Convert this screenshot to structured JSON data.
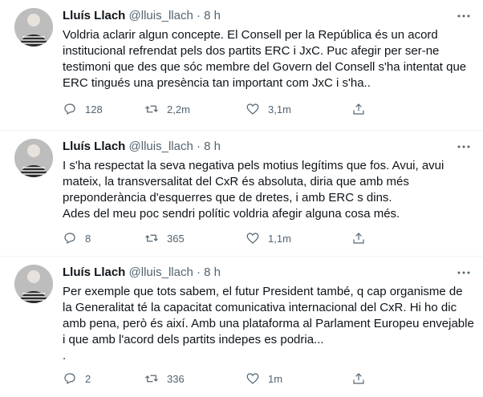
{
  "tweets": [
    {
      "name": "Lluís Llach",
      "handle": "@lluis_llach",
      "time": "8 h",
      "lines": [
        "Voldria aclarir algun concepte. El Consell per la República és un acord",
        "institucional refrendat pels dos partits ERC i JxC. Puc afegir per ser-ne",
        "testimoni que des que sóc membre del Govern del Consell s'ha intentat que",
        "ERC  tingués una presència tan important com JxC i s'ha.."
      ],
      "replies": "128",
      "retweets": "2,2m",
      "likes": "3,1m"
    },
    {
      "name": "Lluís Llach",
      "handle": "@lluis_llach",
      "time": "8 h",
      "lines": [
        "I s'ha respectat la seva negativa pels motius legítims que fos. Avui, avui",
        "mateix, la transversalitat del CxR és absoluta, diria que amb més",
        "preponderància d'esquerres que de dretes, i amb ERC s dins.",
        "Ades del meu poc sendri polític voldria afegir alguna cosa més."
      ],
      "replies": "8",
      "retweets": "365",
      "likes": "1,1m"
    },
    {
      "name": "Lluís Llach",
      "handle": "@lluis_llach",
      "time": "8 h",
      "lines": [
        "Per exemple que tots sabem, el futur President també, q cap organisme de",
        "la Generalitat té la capacitat comunicativa internacional del CxR. Hi ho dic",
        "amb pena, però és així. Amb una plataforma al Parlament Europeu envejable",
        "i que amb l'acord dels partits indepes es podria...",
        "."
      ],
      "replies": "2",
      "retweets": "336",
      "likes": "1m"
    }
  ],
  "icons": {
    "reply": "reply-icon",
    "retweet": "retweet-icon",
    "like": "heart-icon",
    "share": "share-icon",
    "more": "more-icon"
  }
}
